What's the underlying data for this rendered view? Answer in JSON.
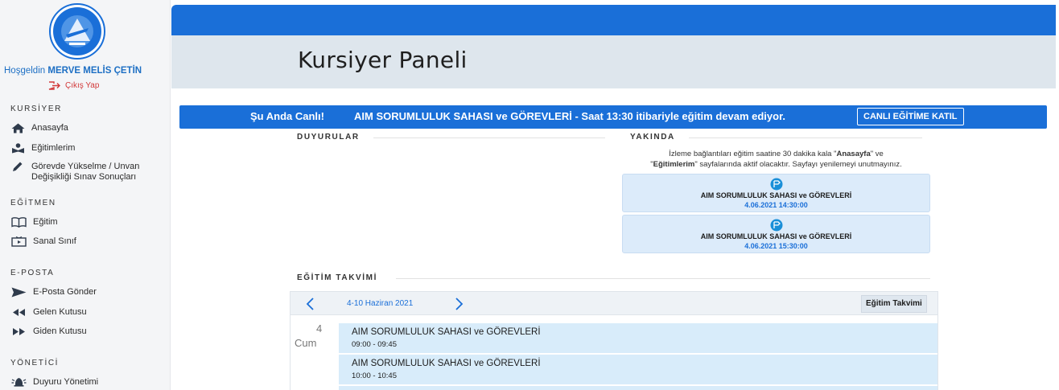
{
  "sidebar": {
    "logo_alt": "DEVLET HAVA MEYDANLARI İŞLETMESİ",
    "welcome_prefix": "Hoşgeldin",
    "user_name": "MERVE MELİS ÇETİN",
    "logout": "Çıkış Yap",
    "sections": [
      {
        "title": "KURSİYER",
        "items": [
          {
            "label": "Anasayfa",
            "icon": "home-icon"
          },
          {
            "label": "Eğitimlerim",
            "icon": "student-icon"
          },
          {
            "label": "Görevde Yükselme / Unvan",
            "label2": "Değişikliği Sınav Sonuçları",
            "icon": "pencil-icon"
          }
        ]
      },
      {
        "title": "EĞİTMEN",
        "items": [
          {
            "label": "Eğitim",
            "icon": "book-icon"
          },
          {
            "label": "Sanal Sınıf",
            "icon": "screen-icon"
          }
        ]
      },
      {
        "title": "E-POSTA",
        "items": [
          {
            "label": "E-Posta Gönder",
            "icon": "send-icon"
          },
          {
            "label": "Gelen Kutusu",
            "icon": "rewind-icon"
          },
          {
            "label": "Giden Kutusu",
            "icon": "forward-icon"
          }
        ]
      },
      {
        "title": "YÖNETİCİ",
        "items": [
          {
            "label": "Duyuru Yönetimi",
            "icon": "bullhorn-icon"
          }
        ]
      }
    ]
  },
  "header": {
    "title": "Kursiyer Paneli"
  },
  "live": {
    "label": "Şu Anda Canlı!",
    "text": "AIM SORUMLULUK SAHASI ve GÖREVLERİ - Saat 13:30 itibariyle eğitim devam ediyor.",
    "button": "CANLI EĞİTİME KATIL"
  },
  "announcements": {
    "title": "DUYURULAR"
  },
  "soon": {
    "title": "YAKINDA",
    "note_1": "İzleme bağlantıları eğitim saatine 30 dakika kala \"",
    "note_bold_1": "Anasayfa",
    "note_2": "\" ve",
    "note_3": "\"",
    "note_bold_2": "Eğitimlerim",
    "note_4": "\" sayfalarında aktif olacaktır. Sayfayı yenilemeyi unutmayınız.",
    "events": [
      {
        "title": "AIM SORUMLULUK SAHASI ve GÖREVLERİ",
        "date": "4.06.2021 14:30:00"
      },
      {
        "title": "AIM SORUMLULUK SAHASI ve GÖREVLERİ",
        "date": "4.06.2021 15:30:00"
      }
    ]
  },
  "calendar": {
    "title": "EĞİTİM TAKVİMİ",
    "range": "4-10 Haziran 2021",
    "button": "Eğitim Takvimi",
    "day_number": "4",
    "day_name": "Cum",
    "events": [
      {
        "title": "AIM SORUMLULUK SAHASI ve GÖREVLERİ",
        "time": "09:00 - 09:45"
      },
      {
        "title": "AIM SORUMLULUK SAHASI ve GÖREVLERİ",
        "time": "10:00 - 10:45"
      }
    ]
  },
  "colors": {
    "primary": "#1a6fd8",
    "header_bg": "#dee6ed",
    "sidebar_bg": "#f4f5f7",
    "danger": "#d23a3a",
    "event_bg": "#d8ecfa"
  }
}
